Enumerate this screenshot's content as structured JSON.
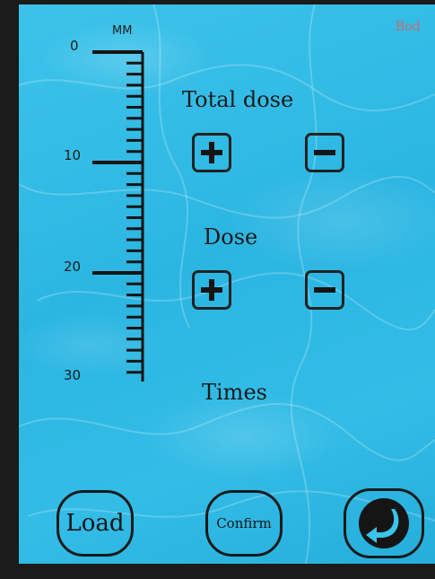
{
  "corner_label": "Bod",
  "ruler": {
    "unit": "MM",
    "labels": [
      "0",
      "10",
      "20",
      "30"
    ]
  },
  "total_dose": {
    "label": "Total dose",
    "plus_icon": "plus-icon",
    "minus_icon": "minus-icon"
  },
  "dose": {
    "label": "Dose",
    "plus_icon": "plus-icon",
    "minus_icon": "minus-icon"
  },
  "times": {
    "label": "Times"
  },
  "buttons": {
    "load": "Load",
    "confirm": "Confirm",
    "back_icon": "return-arrow-icon"
  },
  "colors": {
    "background": "#2bb6e2",
    "ink": "#1a1a1a",
    "frame": "#1b1b1b"
  }
}
